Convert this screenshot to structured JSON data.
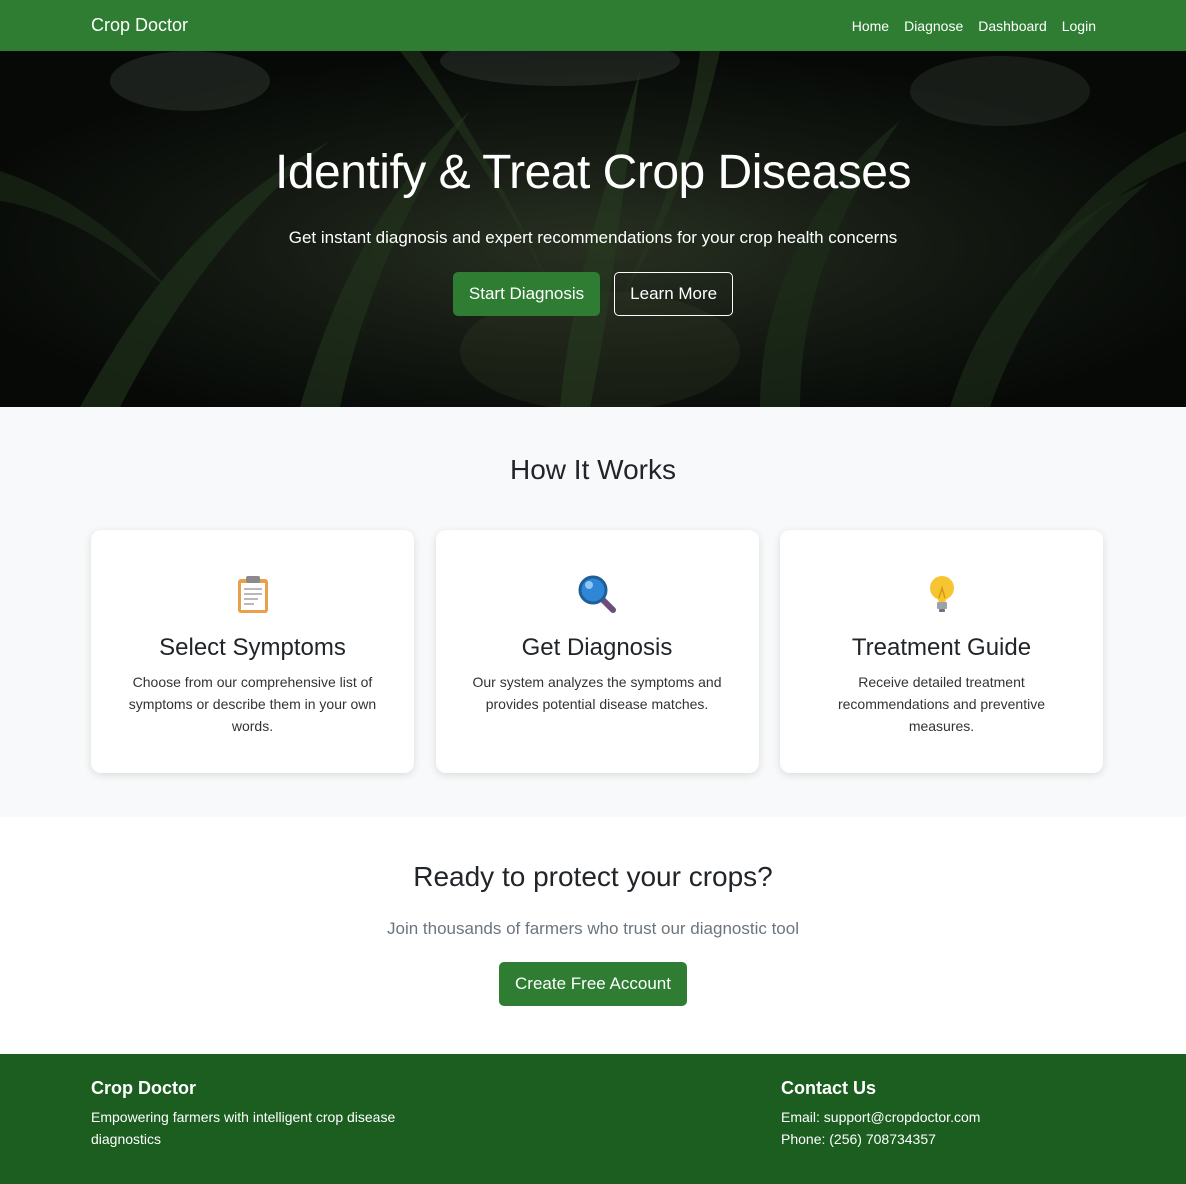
{
  "navbar": {
    "brand": "Crop Doctor",
    "links": [
      "Home",
      "Diagnose",
      "Dashboard",
      "Login"
    ]
  },
  "hero": {
    "title": "Identify & Treat Crop Diseases",
    "subtitle": "Get instant diagnosis and expert recommendations for your crop health concerns",
    "primary_button": "Start Diagnosis",
    "secondary_button": "Learn More"
  },
  "how_it_works": {
    "title": "How It Works",
    "cards": [
      {
        "icon": "clipboard-icon",
        "title": "Select Symptoms",
        "text": "Choose from our comprehensive list of symptoms or describe them in your own words."
      },
      {
        "icon": "magnifier-icon",
        "title": "Get Diagnosis",
        "text": "Our system analyzes the symptoms and provides potential disease matches."
      },
      {
        "icon": "lightbulb-icon",
        "title": "Treatment Guide",
        "text": "Receive detailed treatment recommendations and preventive measures."
      }
    ]
  },
  "cta": {
    "title": "Ready to protect your crops?",
    "subtitle": "Join thousands of farmers who trust our diagnostic tool",
    "button": "Create Free Account"
  },
  "footer": {
    "brand_title": "Crop Doctor",
    "brand_text": "Empowering farmers with intelligent crop disease diagnostics",
    "contact_title": "Contact Us",
    "email": "Email: support@cropdoctor.com",
    "phone": "Phone: (256) 708734357"
  },
  "colors": {
    "primary_green": "#2e7d32",
    "footer_green": "#1b5e20",
    "section_bg": "#f8f9fa"
  }
}
